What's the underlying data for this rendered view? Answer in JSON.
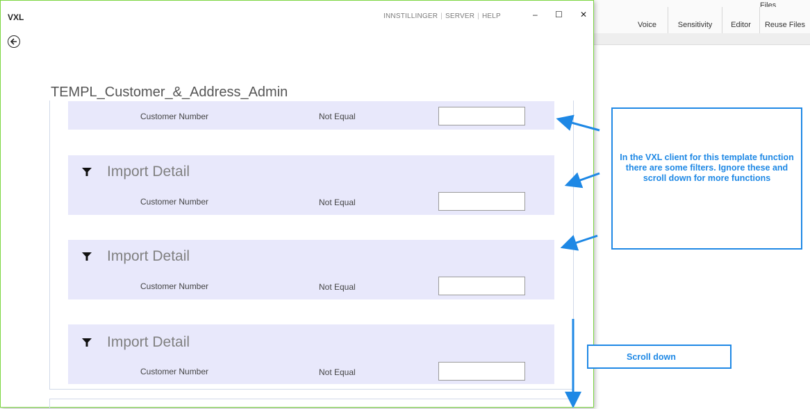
{
  "background_app": {
    "ribbon_groups": [
      "Voice",
      "Sensitivity",
      "Editor",
      "Reuse Files"
    ],
    "files_label": "Files"
  },
  "window": {
    "app_name": "VXL",
    "links": [
      "INNSTILLINGER",
      "SERVER",
      "HELP"
    ],
    "controls": {
      "minimize": "–",
      "maximize": "☐",
      "close": "✕"
    },
    "back_icon": "🡐"
  },
  "page": {
    "title": "TEMPL_Customer_&_Address_Admin"
  },
  "filter_sections": [
    {
      "heading": "",
      "field": "Customer Number",
      "operator": "Not Equal",
      "value": ""
    },
    {
      "heading": "Import Detail",
      "field": "Customer Number",
      "operator": "Not Equal",
      "value": ""
    },
    {
      "heading": "Import Detail",
      "field": "Customer Number",
      "operator": "Not Equal",
      "value": ""
    },
    {
      "heading": "Import Detail",
      "field": "Customer Number",
      "operator": "Not Equal",
      "value": ""
    }
  ],
  "annotations": {
    "callout_text": "In the VXL client for this template function there are some filters. Ignore these and scroll down for more functions",
    "scroll_text": "Scroll down",
    "color": "#1e88e5"
  },
  "icons": {
    "funnel": "filter-funnel-icon",
    "back": "back-arrow-icon"
  }
}
